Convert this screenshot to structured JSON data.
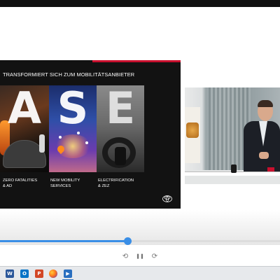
{
  "slide": {
    "title": "TRANSFORMIERT SICH ZUM MOBILITÄTSANBIETER",
    "panel_letters": [
      "A",
      "S",
      "E"
    ],
    "captions": [
      [
        "ZERO FATALITIES",
        "& AD"
      ],
      [
        "NEW MOBILITY",
        "SERVICES"
      ],
      [
        "ELECTRIFICATION",
        "& ZEZ"
      ]
    ],
    "accent_color": "#c8102e"
  },
  "video": {
    "progress_fraction": 0.455
  },
  "controls": {
    "back_icon": "rewind-icon",
    "back_glyph": "⟲",
    "pause_icon": "pause-icon",
    "pause_glyph": "❚❚",
    "forward_icon": "forward-icon",
    "forward_glyph": "⟳",
    "accent": "#3a8ee6"
  },
  "taskbar": {
    "apps": [
      {
        "icon": "word-icon",
        "glyph": "W"
      },
      {
        "icon": "outlook-icon",
        "glyph": "O"
      },
      {
        "icon": "powerpoint-icon",
        "glyph": "P"
      },
      {
        "icon": "firefox-icon",
        "glyph": ""
      },
      {
        "icon": "media-player-icon",
        "glyph": "▶"
      }
    ]
  }
}
